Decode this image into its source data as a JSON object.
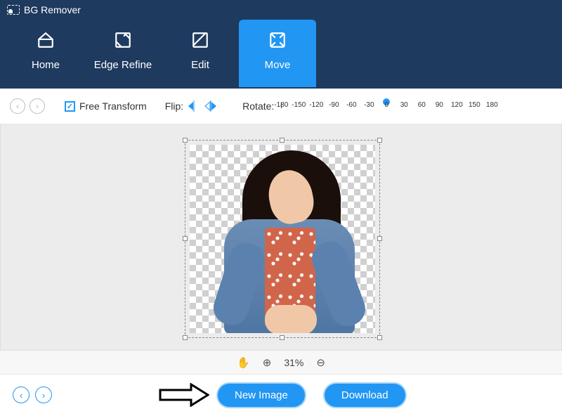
{
  "app": {
    "title": "BG Remover"
  },
  "tabs": [
    {
      "label": "Home"
    },
    {
      "label": "Edge Refine"
    },
    {
      "label": "Edit"
    },
    {
      "label": "Move",
      "active": true
    }
  ],
  "toolbar": {
    "free_transform_label": "Free Transform",
    "flip_label": "Flip:",
    "rotate_label": "Rotate:",
    "rotate_ticks": [
      "-180",
      "-150",
      "-120",
      "-90",
      "-60",
      "-30",
      "0",
      "30",
      "60",
      "90",
      "120",
      "150",
      "180"
    ],
    "rotate_value": 0
  },
  "zoom": {
    "percent_label": "31%"
  },
  "bottom": {
    "new_image_label": "New Image",
    "download_label": "Download"
  }
}
